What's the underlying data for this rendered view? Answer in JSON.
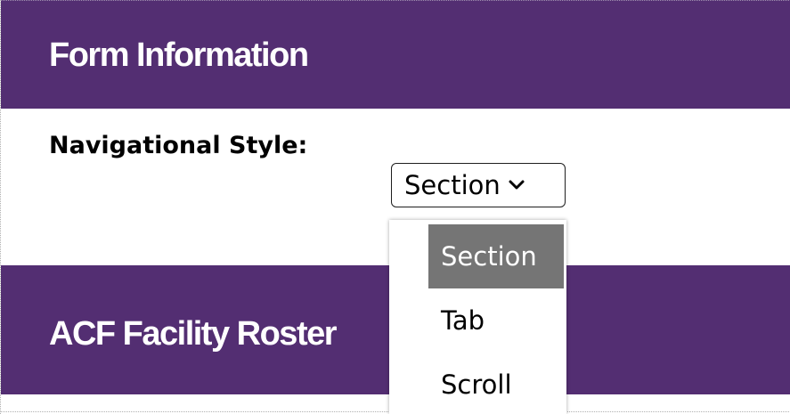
{
  "headers": {
    "form_information": "Form Information",
    "facility_roster": "ACF Facility Roster"
  },
  "navigation": {
    "label": "Navigational Style:",
    "selected_value": "Section",
    "options": [
      "Section",
      "Tab",
      "Scroll"
    ],
    "highlighted_option": "Section"
  },
  "colors": {
    "header_background": "#532e72",
    "header_text": "#ffffff",
    "highlight_background": "#757575"
  },
  "icons": {
    "select_arrow": "chevron-down-icon"
  }
}
